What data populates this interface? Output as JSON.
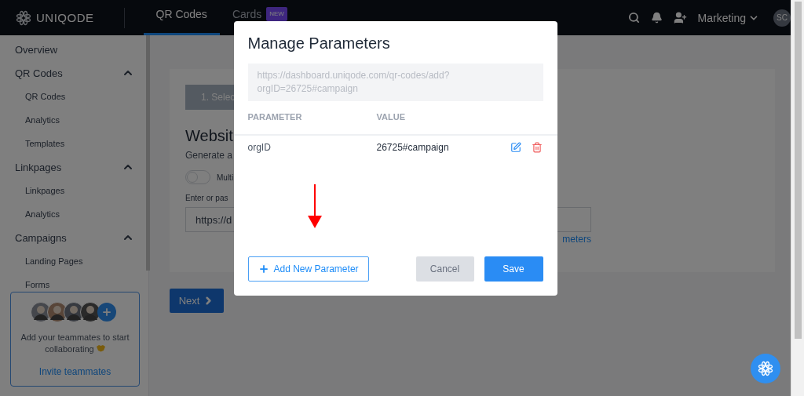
{
  "header": {
    "logo": "UNIQODE",
    "tabs": [
      {
        "label": "QR Codes",
        "selected": true
      },
      {
        "label": "Cards",
        "selected": false,
        "badge": "NEW"
      }
    ],
    "account": "Marketing",
    "avatar": "SC"
  },
  "sidebar": {
    "items": [
      {
        "label": "Overview"
      },
      {
        "label": "QR Codes",
        "expanded": true,
        "children": [
          {
            "label": "QR Codes"
          },
          {
            "label": "Analytics"
          },
          {
            "label": "Templates"
          }
        ]
      },
      {
        "label": "Linkpages",
        "expanded": true,
        "children": [
          {
            "label": "Linkpages"
          },
          {
            "label": "Analytics"
          }
        ]
      },
      {
        "label": "Campaigns",
        "expanded": true,
        "children": [
          {
            "label": "Landing Pages"
          },
          {
            "label": "Forms"
          }
        ]
      }
    ],
    "invite": {
      "text": "Add your teammates to start collaborating",
      "link": "Invite teammates"
    }
  },
  "main": {
    "step": "1. Selec",
    "heading": "Websit",
    "subheading": "Generate a",
    "toggle": {
      "label": "Multi",
      "on": false
    },
    "field_label": "Enter or pas",
    "field_value": "https://d",
    "link": "meters",
    "next_button": "Next"
  },
  "dialog": {
    "title": "Manage Parameters",
    "url": "https://dashboard.uniqode.com/qr-codes/add?\norgID=26725#campaign",
    "columns": [
      "PARAMETER",
      "VALUE"
    ],
    "rows": [
      {
        "parameter": "orgID",
        "value": "26725#campaign"
      }
    ],
    "add_button": "Add New Parameter",
    "cancel_button": "Cancel",
    "save_button": "Save"
  }
}
